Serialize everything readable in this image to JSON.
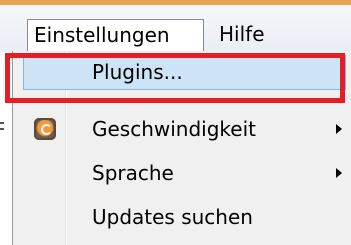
{
  "menubar": {
    "menus": [
      {
        "label": "Einstellungen"
      },
      {
        "label": "Hilfe"
      }
    ]
  },
  "dropdown": {
    "items": [
      {
        "label": "Plugins...",
        "icon": null,
        "submenu": false
      },
      {
        "label": "Geschwindigkeit",
        "icon": "speed-icon",
        "submenu": true
      },
      {
        "label": "Sprache",
        "icon": null,
        "submenu": true
      },
      {
        "label": "Updates suchen",
        "icon": null,
        "submenu": false
      }
    ]
  },
  "colors": {
    "annotation_border": "#e41e26",
    "highlight_fill": "#cde4f7",
    "highlight_border": "#88b5e0",
    "menubar_accent": "#e7a64d"
  }
}
